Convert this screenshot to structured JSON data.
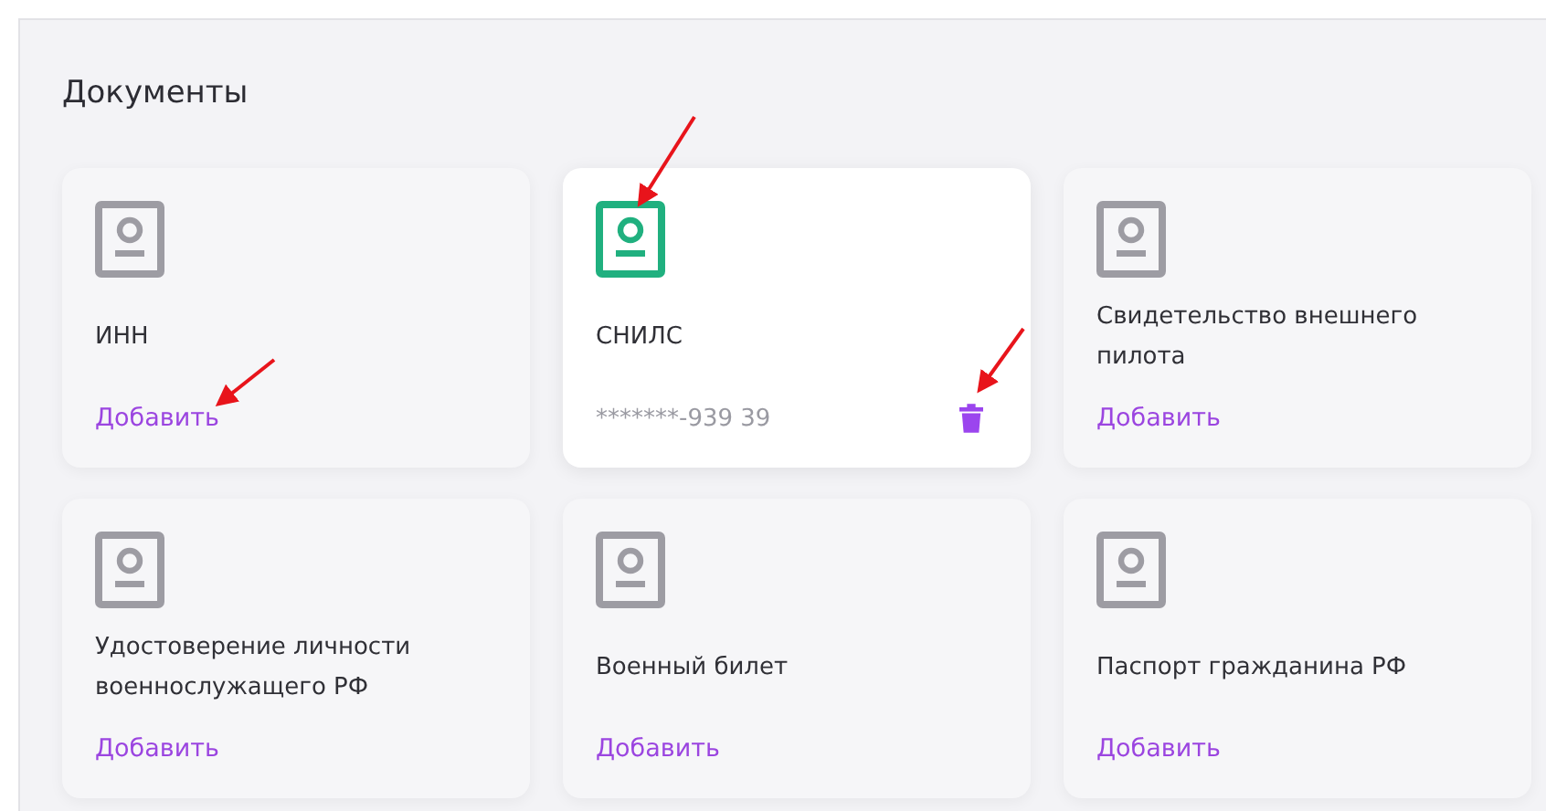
{
  "section": {
    "title": "Документы"
  },
  "documents": [
    {
      "title": "ИНН",
      "filled": false,
      "action": "Добавить"
    },
    {
      "title": "СНИЛС",
      "filled": true,
      "value": "*******-939 39"
    },
    {
      "title": "Свидетельство внешнего пилота",
      "filled": false,
      "action": "Добавить"
    },
    {
      "title": "Удостоверение личности военнослужащего РФ",
      "filled": false,
      "action": "Добавить"
    },
    {
      "title": "Военный билет",
      "filled": false,
      "action": "Добавить"
    },
    {
      "title": "Паспорт гражданина РФ",
      "filled": false,
      "action": "Добавить"
    }
  ]
}
